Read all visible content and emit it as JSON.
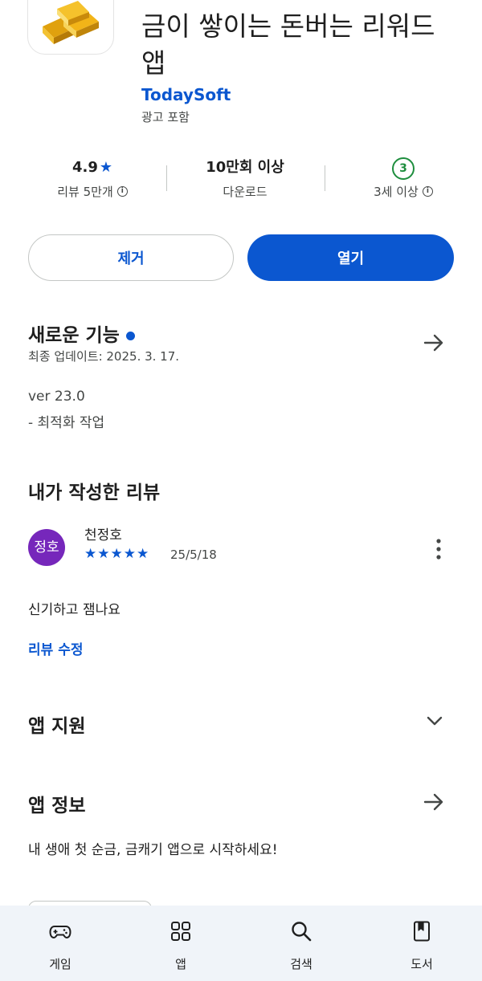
{
  "app": {
    "title": "금이 쌓이는 돈버는 리워드 앱",
    "developer": "TodaySoft",
    "ads_label": "광고 포함"
  },
  "stats": {
    "rating": "4.9",
    "rating_star": "★",
    "reviews_label": "리뷰 5만개",
    "downloads": "10만회 이상",
    "downloads_label": "다운로드",
    "age_badge": "3",
    "age_label": "3세 이상"
  },
  "buttons": {
    "remove": "제거",
    "open": "열기"
  },
  "whats_new": {
    "title": "새로운 기능",
    "updated": "최종 업데이트: 2025. 3. 17.",
    "version": "ver 23.0",
    "notes": "- 최적화 작업"
  },
  "my_review": {
    "title": "내가 작성한 리뷰",
    "avatar_text": "정호",
    "user": "천정호",
    "stars": "★★★★★",
    "date": "25/5/18",
    "text": "신기하고 잼나요",
    "edit_link": "리뷰 수정"
  },
  "app_support": {
    "title": "앱 지원"
  },
  "app_info": {
    "title": "앱 정보",
    "description": "내 생애 첫 순금, 금캐기 앱으로 시작하세요!"
  },
  "bottom_nav": {
    "items": [
      {
        "label": "게임",
        "icon": "gamepad-icon"
      },
      {
        "label": "앱",
        "icon": "apps-grid-icon"
      },
      {
        "label": "검색",
        "icon": "search-icon"
      },
      {
        "label": "도서",
        "icon": "book-icon"
      }
    ]
  },
  "colors": {
    "accent": "#0b57d0",
    "avatar": "#7627bb",
    "age_green": "#1e8e3e",
    "nav_bg": "#f0f4f9"
  }
}
